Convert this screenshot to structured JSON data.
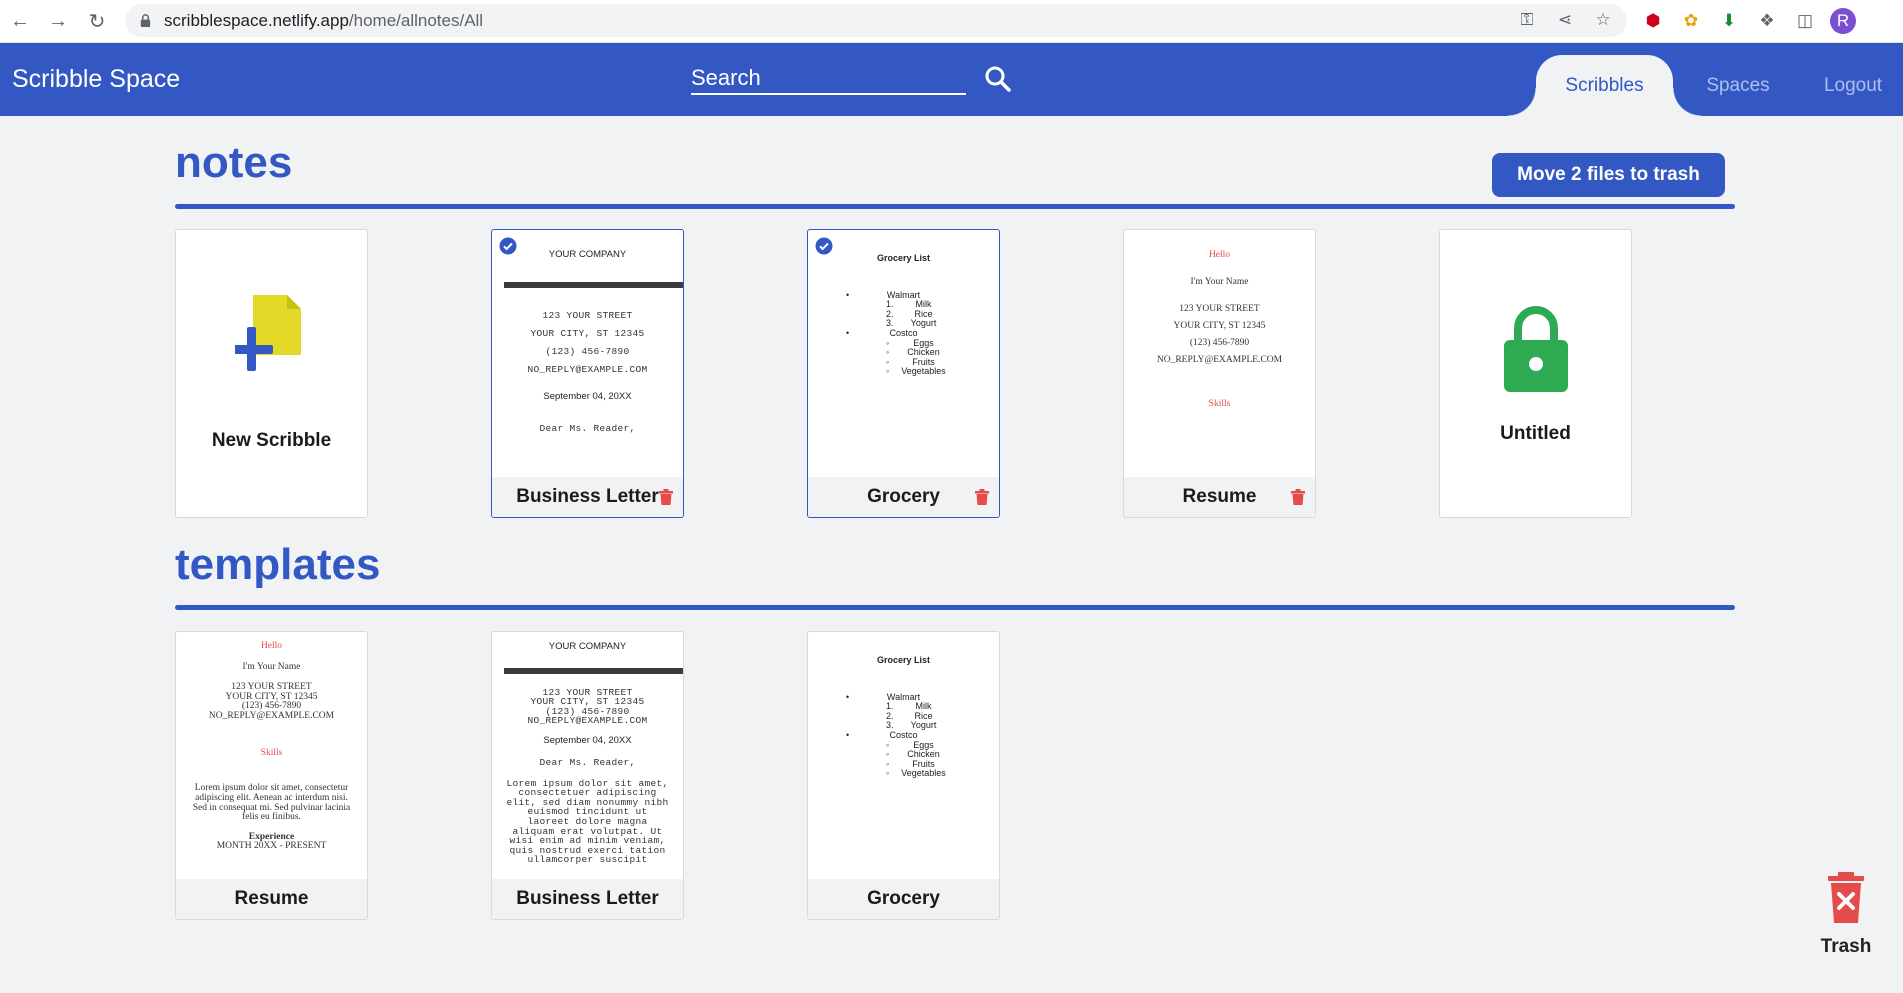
{
  "browser": {
    "url_host": "scribblespace.netlify.app",
    "url_path": "/home/allnotes/All",
    "profile_initial": "R"
  },
  "header": {
    "brand": "Scribble Space",
    "search_label": "Search",
    "tabs": [
      {
        "label": "Scribbles",
        "active": true
      },
      {
        "label": "Spaces",
        "active": false
      },
      {
        "label": "Logout",
        "active": false
      }
    ]
  },
  "notes": {
    "title": "notes",
    "move_button": "Move 2 files to trash",
    "new_scribble_label": "New Scribble",
    "cards": [
      {
        "name": "Business Letter",
        "selected": true,
        "preview": {
          "company": "YOUR COMPANY",
          "street": "123 YOUR STREET",
          "city": "YOUR CITY, ST 12345",
          "phone": "(123) 456-7890",
          "email": "NO_REPLY@EXAMPLE.COM",
          "date": "September 04, 20XX",
          "greeting": "Dear Ms. Reader,"
        }
      },
      {
        "name": "Grocery",
        "selected": true,
        "preview": {
          "title": "Grocery List",
          "store1": "Walmart",
          "store1_items": [
            "Milk",
            "Rice",
            "Yogurt"
          ],
          "store2": "Costco",
          "store2_items": [
            "Eggs",
            "Chicken",
            "Fruits",
            "Vegetables"
          ]
        }
      },
      {
        "name": "Resume",
        "selected": false,
        "preview": {
          "hello": "Hello",
          "name": "I'm Your Name",
          "street": "123 YOUR STREET",
          "city": "YOUR CITY, ST 12345",
          "phone": "(123) 456-7890",
          "email": "NO_REPLY@EXAMPLE.COM",
          "skills": "Skills"
        }
      }
    ],
    "locked_label": "Untitled"
  },
  "templates": {
    "title": "templates",
    "cards": [
      {
        "name": "Resume",
        "preview": {
          "hello": "Hello",
          "name": "I'm Your Name",
          "street": "123 YOUR STREET",
          "city": "YOUR CITY, ST 12345",
          "phone": "(123) 456-7890",
          "email": "NO_REPLY@EXAMPLE.COM",
          "skills": "Skills",
          "lorem": "Lorem ipsum dolor sit amet, consectetur adipiscing elit. Aenean ac interdum nisi. Sed in consequat mi. Sed pulvinar lacinia felis eu finibus.",
          "experience": "Experience",
          "month": "MONTH 20XX - PRESENT"
        }
      },
      {
        "name": "Business Letter",
        "preview": {
          "company": "YOUR COMPANY",
          "street": "123 YOUR STREET",
          "city": "YOUR CITY, ST 12345",
          "phone": "(123) 456-7890",
          "email": "NO_REPLY@EXAMPLE.COM",
          "date": "September 04, 20XX",
          "greeting": "Dear Ms. Reader,",
          "lorem": "Lorem ipsum dolor sit amet, consectetuer adipiscing elit, sed diam nonummy nibh euismod tincidunt ut laoreet dolore magna aliquam erat volutpat. Ut wisi enim ad minim veniam, quis nostrud exerci tation ullamcorper suscipit"
        }
      },
      {
        "name": "Grocery",
        "preview": {
          "title": "Grocery List",
          "store1": "Walmart",
          "store1_items": [
            "Milk",
            "Rice",
            "Yogurt"
          ],
          "store2": "Costco",
          "store2_items": [
            "Eggs",
            "Chicken",
            "Fruits",
            "Vegetables"
          ]
        }
      }
    ]
  },
  "trash": {
    "label": "Trash"
  },
  "colors": {
    "brand": "#3358c4",
    "danger": "#e44b4b",
    "lock": "#2eaa52",
    "file": "#e4d926"
  }
}
